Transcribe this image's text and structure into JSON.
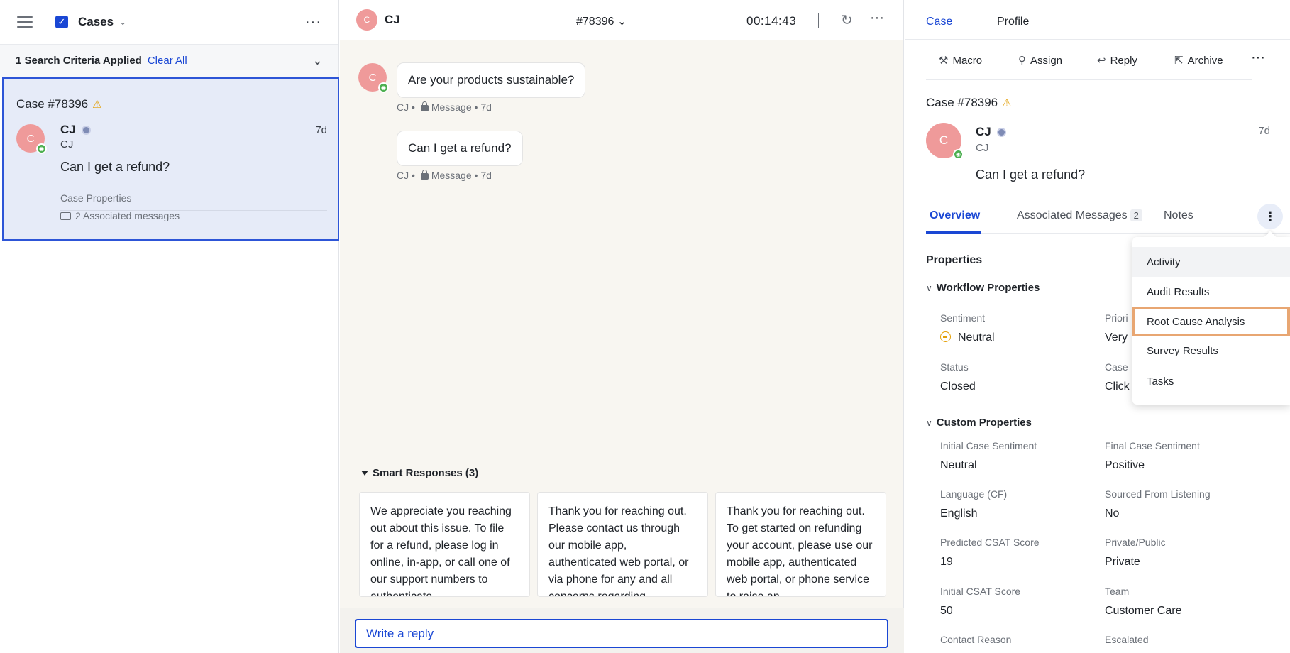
{
  "left": {
    "title": "Cases",
    "criteria_text": "1 Search Criteria Applied",
    "clear_all": "Clear All",
    "card": {
      "case_number": "Case #78396",
      "avatar_letter": "C",
      "name": "CJ",
      "sub": "CJ",
      "time": "7d",
      "message": "Can I get a refund?",
      "properties_label": "Case Properties",
      "associated": "2 Associated messages"
    }
  },
  "middle": {
    "avatar_letter": "C",
    "name": "CJ",
    "case_id": "#78396",
    "timer": "00:14:43",
    "messages": [
      {
        "text": "Are your products sustainable?",
        "author": "CJ",
        "channel": "Message",
        "time": "7d"
      },
      {
        "text": "Can I get a refund?",
        "author": "CJ",
        "channel": "Message",
        "time": "7d"
      }
    ],
    "smart_responses_title": "Smart Responses (3)",
    "smart_responses": [
      "We appreciate you reaching out about this issue. To file for a refund, please log in online, in-app, or call one of our support numbers to authenticate",
      "Thank you for reaching out. Please contact us through our mobile app, authenticated web portal, or via phone for any and all concerns regarding",
      "Thank you for reaching out. To get started on refunding your account, please use our mobile app, authenticated web portal, or phone service to raise an"
    ],
    "reply_placeholder": "Write a reply"
  },
  "right": {
    "tabs": [
      "Case",
      "Profile"
    ],
    "toolbar": {
      "macro": "Macro",
      "assign": "Assign",
      "reply": "Reply",
      "archive": "Archive"
    },
    "case_number": "Case #78396",
    "avatar_letter": "C",
    "name": "CJ",
    "sub": "CJ",
    "time": "7d",
    "message": "Can I get a refund?",
    "sub_tabs": {
      "overview": "Overview",
      "associated": "Associated Messages",
      "associated_count": "2",
      "notes": "Notes"
    },
    "properties_title": "Properties",
    "workflow_title": "Workflow Properties",
    "custom_title": "Custom Properties",
    "workflow": {
      "sentiment_label": "Sentiment",
      "sentiment_value": "Neutral",
      "priority_label": "Priori",
      "priority_value": "Very",
      "status_label": "Status",
      "status_value": "Closed",
      "case_label": "Case",
      "case_value": "Click"
    },
    "custom": [
      {
        "label": "Initial Case Sentiment",
        "value": "Neutral"
      },
      {
        "label": "Final Case Sentiment",
        "value": "Positive"
      },
      {
        "label": "Language (CF)",
        "value": "English"
      },
      {
        "label": "Sourced From Listening",
        "value": "No"
      },
      {
        "label": "Predicted CSAT Score",
        "value": "19"
      },
      {
        "label": "Private/Public",
        "value": "Private"
      },
      {
        "label": "Initial CSAT Score",
        "value": "50"
      },
      {
        "label": "Team",
        "value": "Customer Care"
      },
      {
        "label": "Contact Reason",
        "value": ""
      },
      {
        "label": "Escalated",
        "value": ""
      }
    ],
    "dropdown": [
      "Activity",
      "Audit Results",
      "Root Cause Analysis",
      "Survey Results",
      "Tasks"
    ]
  },
  "colors": {
    "accent": "#1a47d4",
    "selected_card": "#e6ebf8",
    "avatar": "#ef9a9a",
    "highlight_outline": "#e8a672",
    "warning": "#e3a008"
  }
}
